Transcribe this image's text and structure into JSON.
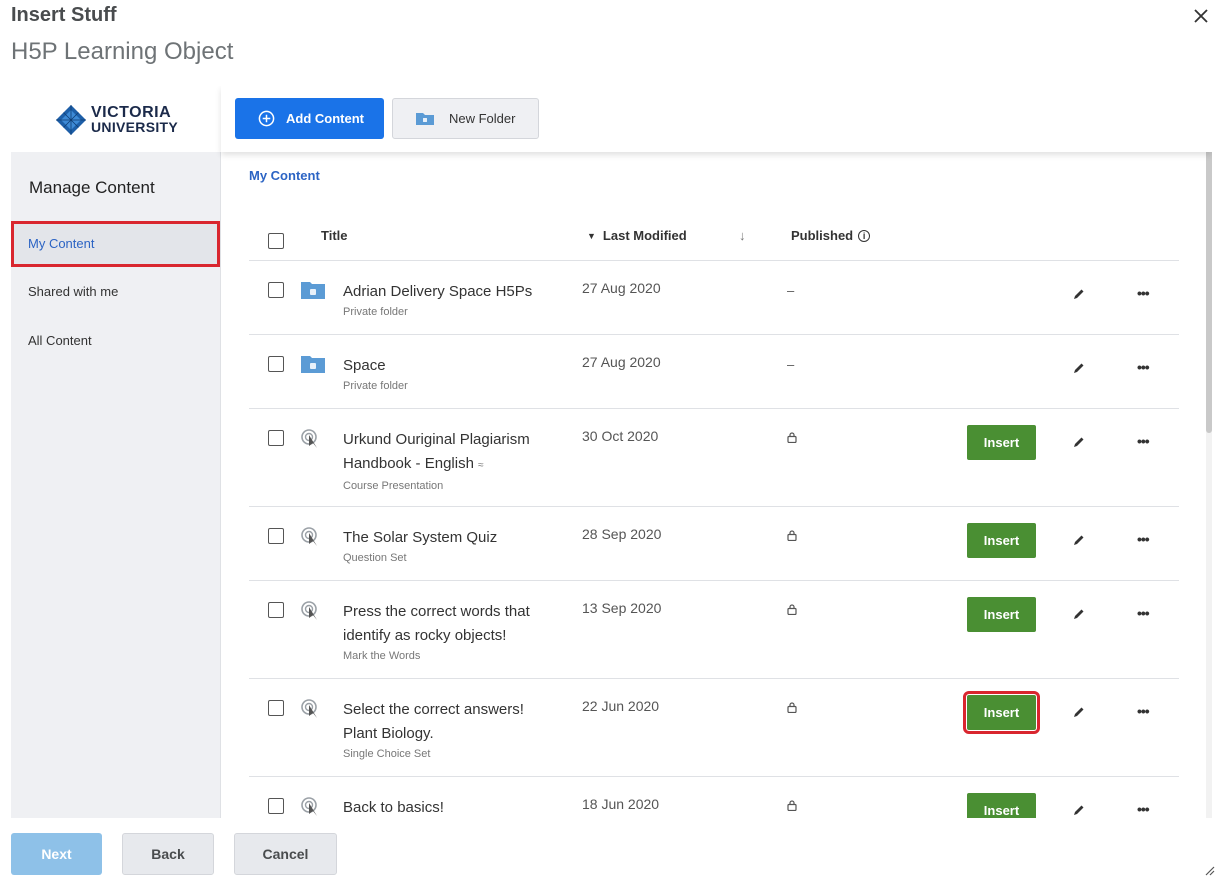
{
  "dialog": {
    "title": "Insert Stuff",
    "subtitle": "H5P Learning Object"
  },
  "logo": {
    "line1": "VICTORIA",
    "line2": "UNIVERSITY"
  },
  "sidebar": {
    "heading": "Manage Content",
    "items": [
      {
        "label": "My Content",
        "active": true
      },
      {
        "label": "Shared with me",
        "active": false
      },
      {
        "label": "All Content",
        "active": false
      }
    ]
  },
  "toolbar": {
    "add_label": "Add Content",
    "folder_label": "New Folder"
  },
  "breadcrumb": "My Content",
  "table": {
    "headers": {
      "title": "Title",
      "modified": "Last Modified",
      "sort_arrow": "↓",
      "published": "Published",
      "info": "i"
    },
    "rows": [
      {
        "line1": "Adrian Delivery Space H5Ps",
        "line2": "",
        "type": "Private folder",
        "date": "27 Aug 2020",
        "published": "–",
        "kind": "folder",
        "insert": ""
      },
      {
        "line1": "Space",
        "line2": "",
        "type": "Private folder",
        "date": "27 Aug 2020",
        "published": "–",
        "kind": "folder",
        "insert": ""
      },
      {
        "line1": "Urkund Ouriginal Plagiarism",
        "line2": "Handbook - English",
        "type": "Course Presentation",
        "date": "30 Oct 2020",
        "published": "lock",
        "kind": "h5p",
        "insert": "Insert",
        "shared": true
      },
      {
        "line1": "The Solar System Quiz",
        "line2": "",
        "type": "Question Set",
        "date": "28 Sep 2020",
        "published": "lock",
        "kind": "h5p",
        "insert": "Insert"
      },
      {
        "line1": "Press the correct words that",
        "line2": "identify as rocky objects!",
        "type": "Mark the Words",
        "date": "13 Sep 2020",
        "published": "lock",
        "kind": "h5p",
        "insert": "Insert"
      },
      {
        "line1": "Select the correct answers!",
        "line2": "Plant Biology.",
        "type": "Single Choice Set",
        "date": "22 Jun 2020",
        "published": "lock",
        "kind": "h5p",
        "insert": "Insert",
        "highlight": true
      },
      {
        "line1": "Back to basics!",
        "line2": "",
        "type": "",
        "date": "18 Jun 2020",
        "published": "lock",
        "kind": "h5p",
        "insert": "Insert"
      }
    ]
  },
  "footer": {
    "next": "Next",
    "back": "Back",
    "cancel": "Cancel"
  },
  "colors": {
    "primary": "#1a73e8",
    "insert": "#4a8f33",
    "highlight": "#d9262f",
    "link": "#2c64c4"
  }
}
